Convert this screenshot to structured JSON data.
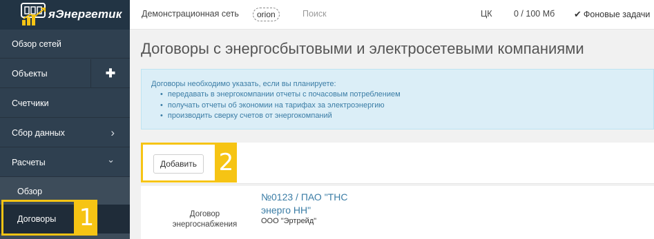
{
  "app": {
    "logo_text": "яЭнергетик"
  },
  "sidebar": {
    "items": [
      {
        "label": "Обзор сетей"
      },
      {
        "label": "Объекты",
        "action_icon": "plus-icon",
        "action_glyph": "✚"
      },
      {
        "label": "Счетчики"
      },
      {
        "label": "Сбор данных",
        "icon": "chevron-right-icon",
        "glyph": "›"
      },
      {
        "label": "Расчеты",
        "icon": "chevron-down-icon",
        "glyph": "⌄"
      }
    ],
    "sub_items": [
      {
        "label": "Обзор"
      },
      {
        "label": "Договоры",
        "active": true
      }
    ]
  },
  "topbar": {
    "network_name": "Демонстрационная сеть",
    "user": "orion",
    "search_label": "Поиск",
    "region": "ЦК",
    "storage": "0 / 100 Мб",
    "tasks_label": "Фоновые задачи"
  },
  "main": {
    "title": "Договоры с энергосбытовыми и электросетевыми компаниями",
    "info": {
      "intro": "Договоры необходимо указать, если вы планируете:",
      "bullets": [
        "передавать в энергокомпании отчеты с почасовым потреблением",
        "получать отчеты об экономии на тарифах за электроэнергию",
        "производить сверку счетов от энергокомпаний"
      ]
    },
    "add_button": "Добавить",
    "contracts": [
      {
        "type": "Договор энергоснабжения",
        "title": "№0123 / ПАО \"ТНС энерго НН\"",
        "counterparty": "ООО \"Эртрейд\""
      }
    ]
  },
  "annotations": {
    "marker_1": "1",
    "marker_2": "2"
  },
  "colors": {
    "sidebar_bg": "#2f4050",
    "highlight": "#f6c414",
    "link": "#3a7ca5",
    "info_bg": "#dbeef7"
  }
}
